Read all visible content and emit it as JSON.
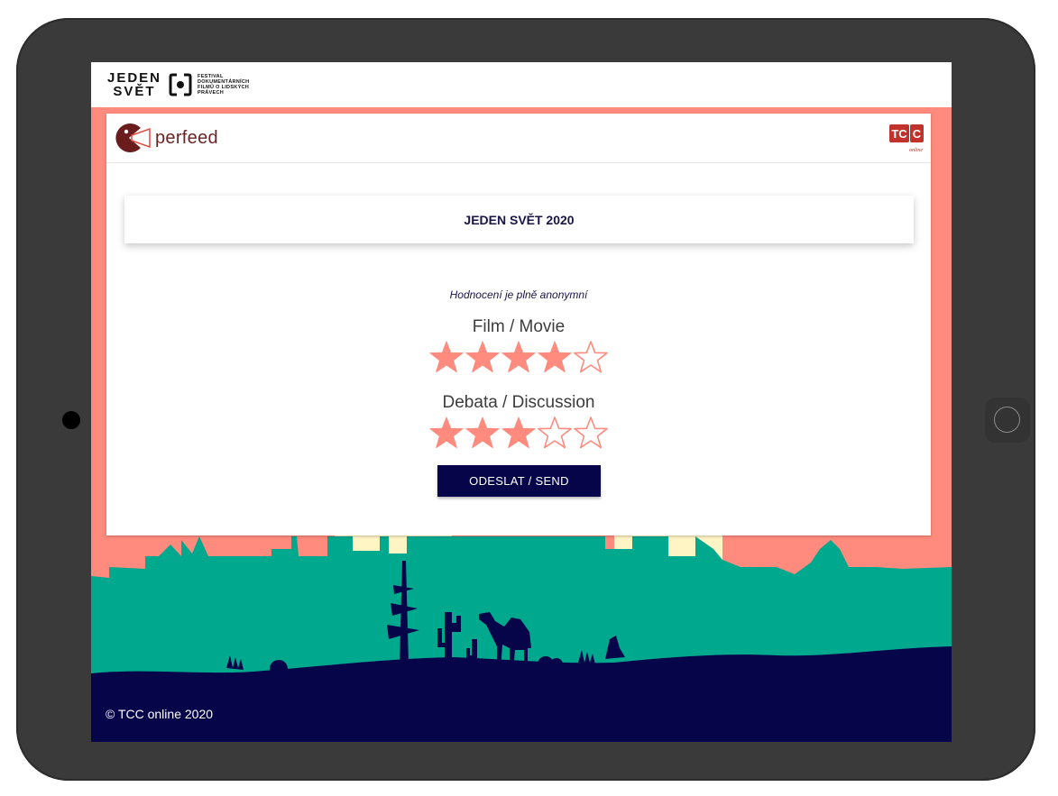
{
  "header": {
    "festival_logo": {
      "line1": "JEDEN",
      "line2": "SVĚT",
      "tagline": [
        "FESTIVAL",
        "DOKUMENTÁRNÍCH",
        "FILMŮ O LIDSKÝCH",
        "PRÁVECH"
      ]
    }
  },
  "card": {
    "brand_name": "perfeed",
    "partner_logo": {
      "letters": "TC",
      "accent_letter": "C",
      "sub": "online"
    },
    "event_title": "JEDEN SVĚT 2020",
    "anonymity_note": "Hodnocení je plně anonymní",
    "ratings": [
      {
        "label": "Film / Movie",
        "value": 4,
        "max": 5
      },
      {
        "label": "Debata / Discussion",
        "value": 3,
        "max": 5
      }
    ],
    "send_button": "ODESLAT / SEND"
  },
  "footer": {
    "copyright": "© TCC online 2020"
  },
  "colors": {
    "accent": "#ff8b7e",
    "navy": "#07054a",
    "teal": "#00a98e",
    "brand_red": "#c0322b",
    "device": "#3a3a3a"
  },
  "icons": {
    "rating_star": "star-icon",
    "brand_mark": "perfeed-pacman-icon"
  }
}
